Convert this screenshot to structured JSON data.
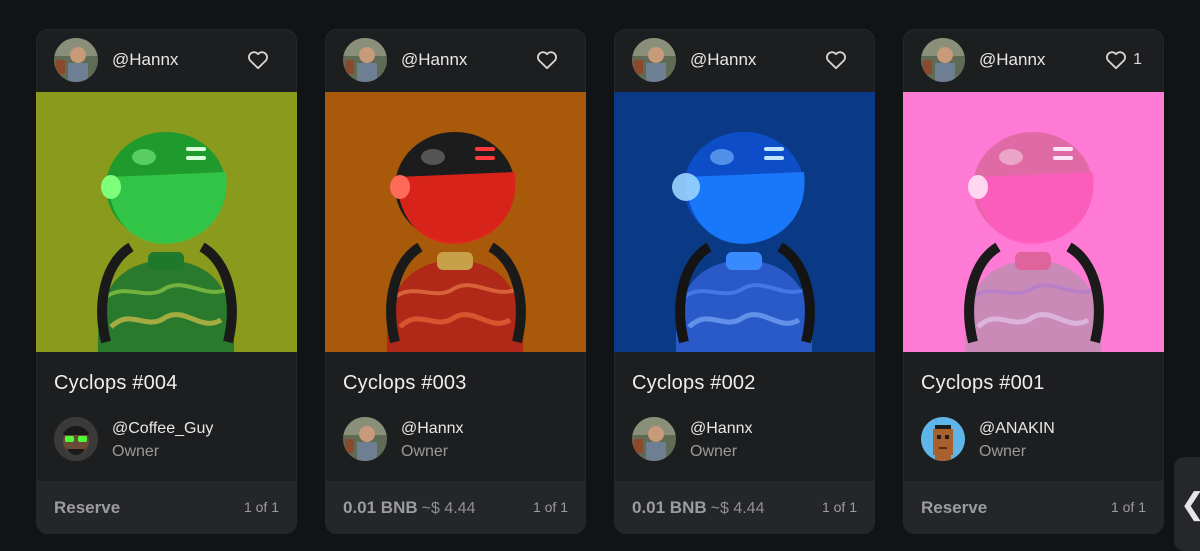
{
  "cards": [
    {
      "creator": "@Hannx",
      "like_count": "",
      "title": "Cyclops #004",
      "owner": "@Coffee_Guy",
      "owner_label": "Owner",
      "price": "Reserve",
      "price_usd": "",
      "edition": "1 of 1",
      "art_bg": "#8a9a1c",
      "helmet_color": "#2ecc3a",
      "owner_avatar": "coffee-guy-avatar"
    },
    {
      "creator": "@Hannx",
      "like_count": "",
      "title": "Cyclops #003",
      "owner": "@Hannx",
      "owner_label": "Owner",
      "price": "0.01 BNB",
      "price_usd": "~$ 4.44",
      "edition": "1 of 1",
      "art_bg": "#a9590a",
      "helmet_color": "#e8241a",
      "owner_avatar": "hannx-avatar"
    },
    {
      "creator": "@Hannx",
      "like_count": "",
      "title": "Cyclops #002",
      "owner": "@Hannx",
      "owner_label": "Owner",
      "price": "0.01 BNB",
      "price_usd": "~$ 4.44",
      "edition": "1 of 1",
      "art_bg": "#0a3a86",
      "helmet_color": "#1b7cff",
      "owner_avatar": "hannx-avatar"
    },
    {
      "creator": "@Hannx",
      "like_count": "1",
      "title": "Cyclops #001",
      "owner": "@ANAKIN",
      "owner_label": "Owner",
      "price": "Reserve",
      "price_usd": "",
      "edition": "1 of 1",
      "art_bg": "#ff7ad4",
      "helmet_color": "#ff5bbd",
      "owner_avatar": "anakin-avatar"
    }
  ],
  "icons": {
    "like": "heart-outline-icon",
    "side_tab": "chevron-left-icon"
  },
  "side_tab_glyph": "❮"
}
